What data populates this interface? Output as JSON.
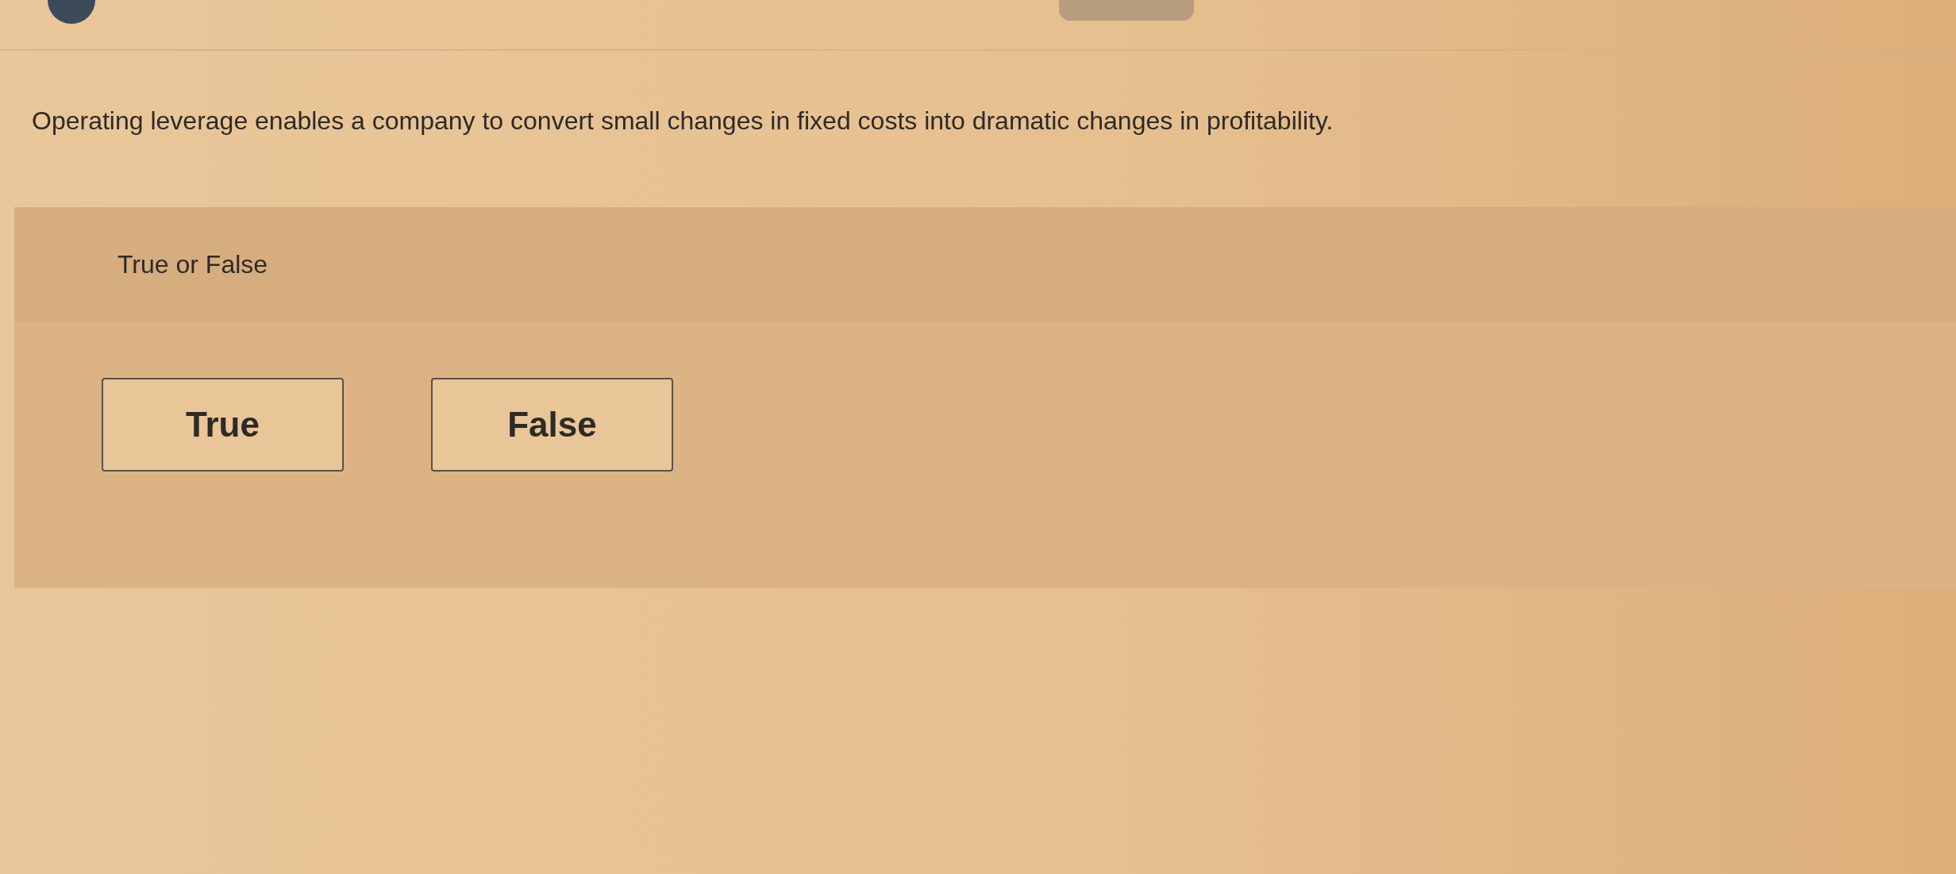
{
  "question": {
    "text": "Operating leverage enables a company to convert small changes in fixed costs into dramatic changes in profitability."
  },
  "answer_panel": {
    "prompt": "True or False",
    "options": [
      {
        "label": "True",
        "selected": false
      },
      {
        "label": "False",
        "selected": false
      }
    ]
  }
}
